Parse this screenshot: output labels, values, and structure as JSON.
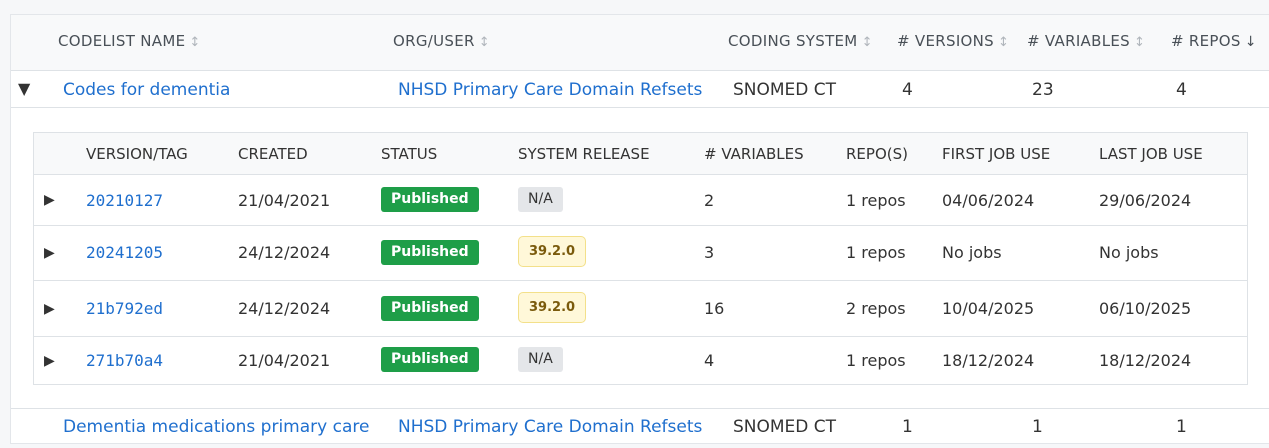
{
  "table": {
    "headers": {
      "name": "CODELIST NAME",
      "org": "ORG/USER",
      "system": "CODING SYSTEM",
      "versions": "# VERSIONS",
      "variables": "# VARIABLES",
      "repos": "# REPOS"
    },
    "sort_icons": {
      "inactive": "↕",
      "active": "↓"
    },
    "rows": [
      {
        "name": "Codes for dementia",
        "org": "NHSD Primary Care Domain Refsets",
        "system": "SNOMED CT",
        "versions": "4",
        "variables": "23",
        "repos": "4",
        "expanded_icon": "▼"
      },
      {
        "name": "Dementia medications primary care",
        "org": "NHSD Primary Care Domain Refsets",
        "system": "SNOMED CT",
        "versions": "1",
        "variables": "1",
        "repos": "1"
      }
    ]
  },
  "versions": {
    "headers": {
      "tag": "VERSION/TAG",
      "created": "CREATED",
      "status": "STATUS",
      "release": "SYSTEM RELEASE",
      "variables": "# VARIABLES",
      "repos": "REPO(S)",
      "first": "FIRST JOB USE",
      "last": "LAST JOB USE"
    },
    "expand_icon": "▶",
    "rows": [
      {
        "tag": "20210127",
        "created": "21/04/2021",
        "status": "Published",
        "release": "N/A",
        "variables": "2",
        "repos": "1 repos",
        "first": "04/06/2024",
        "last": "29/06/2024"
      },
      {
        "tag": "20241205",
        "created": "24/12/2024",
        "status": "Published",
        "release": "39.2.0",
        "variables": "3",
        "repos": "1 repos",
        "first": "No jobs",
        "last": "No jobs"
      },
      {
        "tag": "21b792ed",
        "created": "24/12/2024",
        "status": "Published",
        "release": "39.2.0",
        "variables": "16",
        "repos": "2 repos",
        "first": "10/04/2025",
        "last": "06/10/2025"
      },
      {
        "tag": "271b70a4",
        "created": "21/04/2021",
        "status": "Published",
        "release": "N/A",
        "variables": "4",
        "repos": "1 repos",
        "first": "18/12/2024",
        "last": "18/12/2024"
      }
    ]
  },
  "colors": {
    "link": "#1f6fce",
    "published": "#1e9e48",
    "release_badge": "#fff8d9",
    "na_badge": "#e4e6e9"
  }
}
